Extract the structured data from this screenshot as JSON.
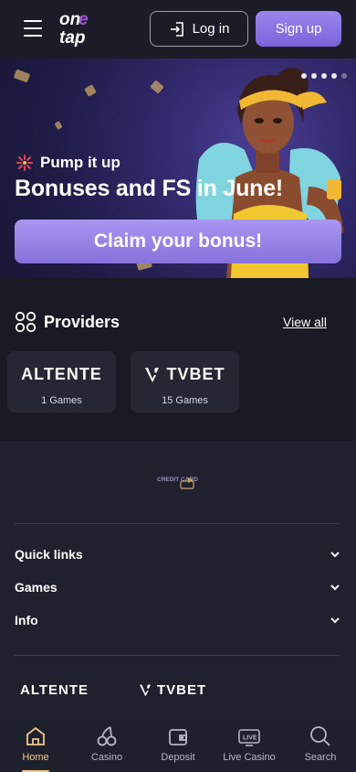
{
  "header": {
    "logo_text": "one tap",
    "login_label": "Log in",
    "signup_label": "Sign up"
  },
  "banner": {
    "tag": "Pump it up",
    "title": "Bonuses and FS in June!",
    "cta": "Claim your bonus!",
    "slides_total": 5,
    "active_slide": 4
  },
  "providers": {
    "title": "Providers",
    "view_all": "View all",
    "items": [
      {
        "name": "ALTENTE",
        "count": "1 Games"
      },
      {
        "name": "TVBET",
        "count": "15 Games"
      }
    ]
  },
  "footer": {
    "payment_label": "CREDIT CARD",
    "sections": [
      "Quick links",
      "Games",
      "Info"
    ],
    "logos": [
      "ALTENTE",
      "TVBET"
    ]
  },
  "nav": {
    "items": [
      {
        "label": "Home",
        "icon": "home-icon",
        "active": true
      },
      {
        "label": "Casino",
        "icon": "cherries-icon"
      },
      {
        "label": "Deposit",
        "icon": "wallet-icon"
      },
      {
        "label": "Live Casino",
        "icon": "live-tv-icon"
      },
      {
        "label": "Search",
        "icon": "search-icon"
      }
    ]
  },
  "colors": {
    "accent": "#8672dc",
    "active_nav": "#f1c88a",
    "background": "#1b1b26"
  }
}
